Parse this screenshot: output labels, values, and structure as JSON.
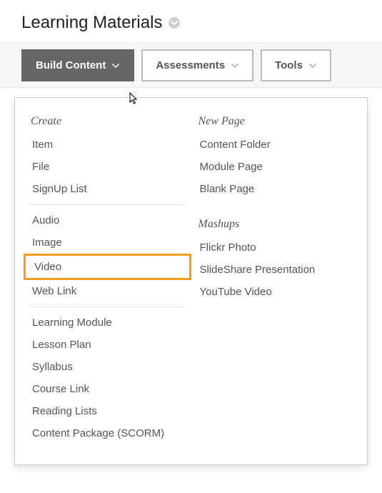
{
  "page": {
    "title": "Learning Materials"
  },
  "toolbar": {
    "build_content": "Build Content",
    "assessments": "Assessments",
    "tools": "Tools"
  },
  "dropdown": {
    "create": {
      "heading": "Create",
      "group1": [
        "Item",
        "File",
        "SignUp List"
      ],
      "group2": [
        "Audio",
        "Image",
        "Video",
        "Web Link"
      ],
      "group3": [
        "Learning Module",
        "Lesson Plan",
        "Syllabus",
        "Course Link",
        "Reading Lists",
        "Content Package (SCORM)"
      ]
    },
    "new_page": {
      "heading": "New Page",
      "items": [
        "Content Folder",
        "Module Page",
        "Blank Page"
      ]
    },
    "mashups": {
      "heading": "Mashups",
      "items": [
        "Flickr Photo",
        "SlideShare Presentation",
        "YouTube Video"
      ]
    }
  },
  "highlighted_item": "Video"
}
